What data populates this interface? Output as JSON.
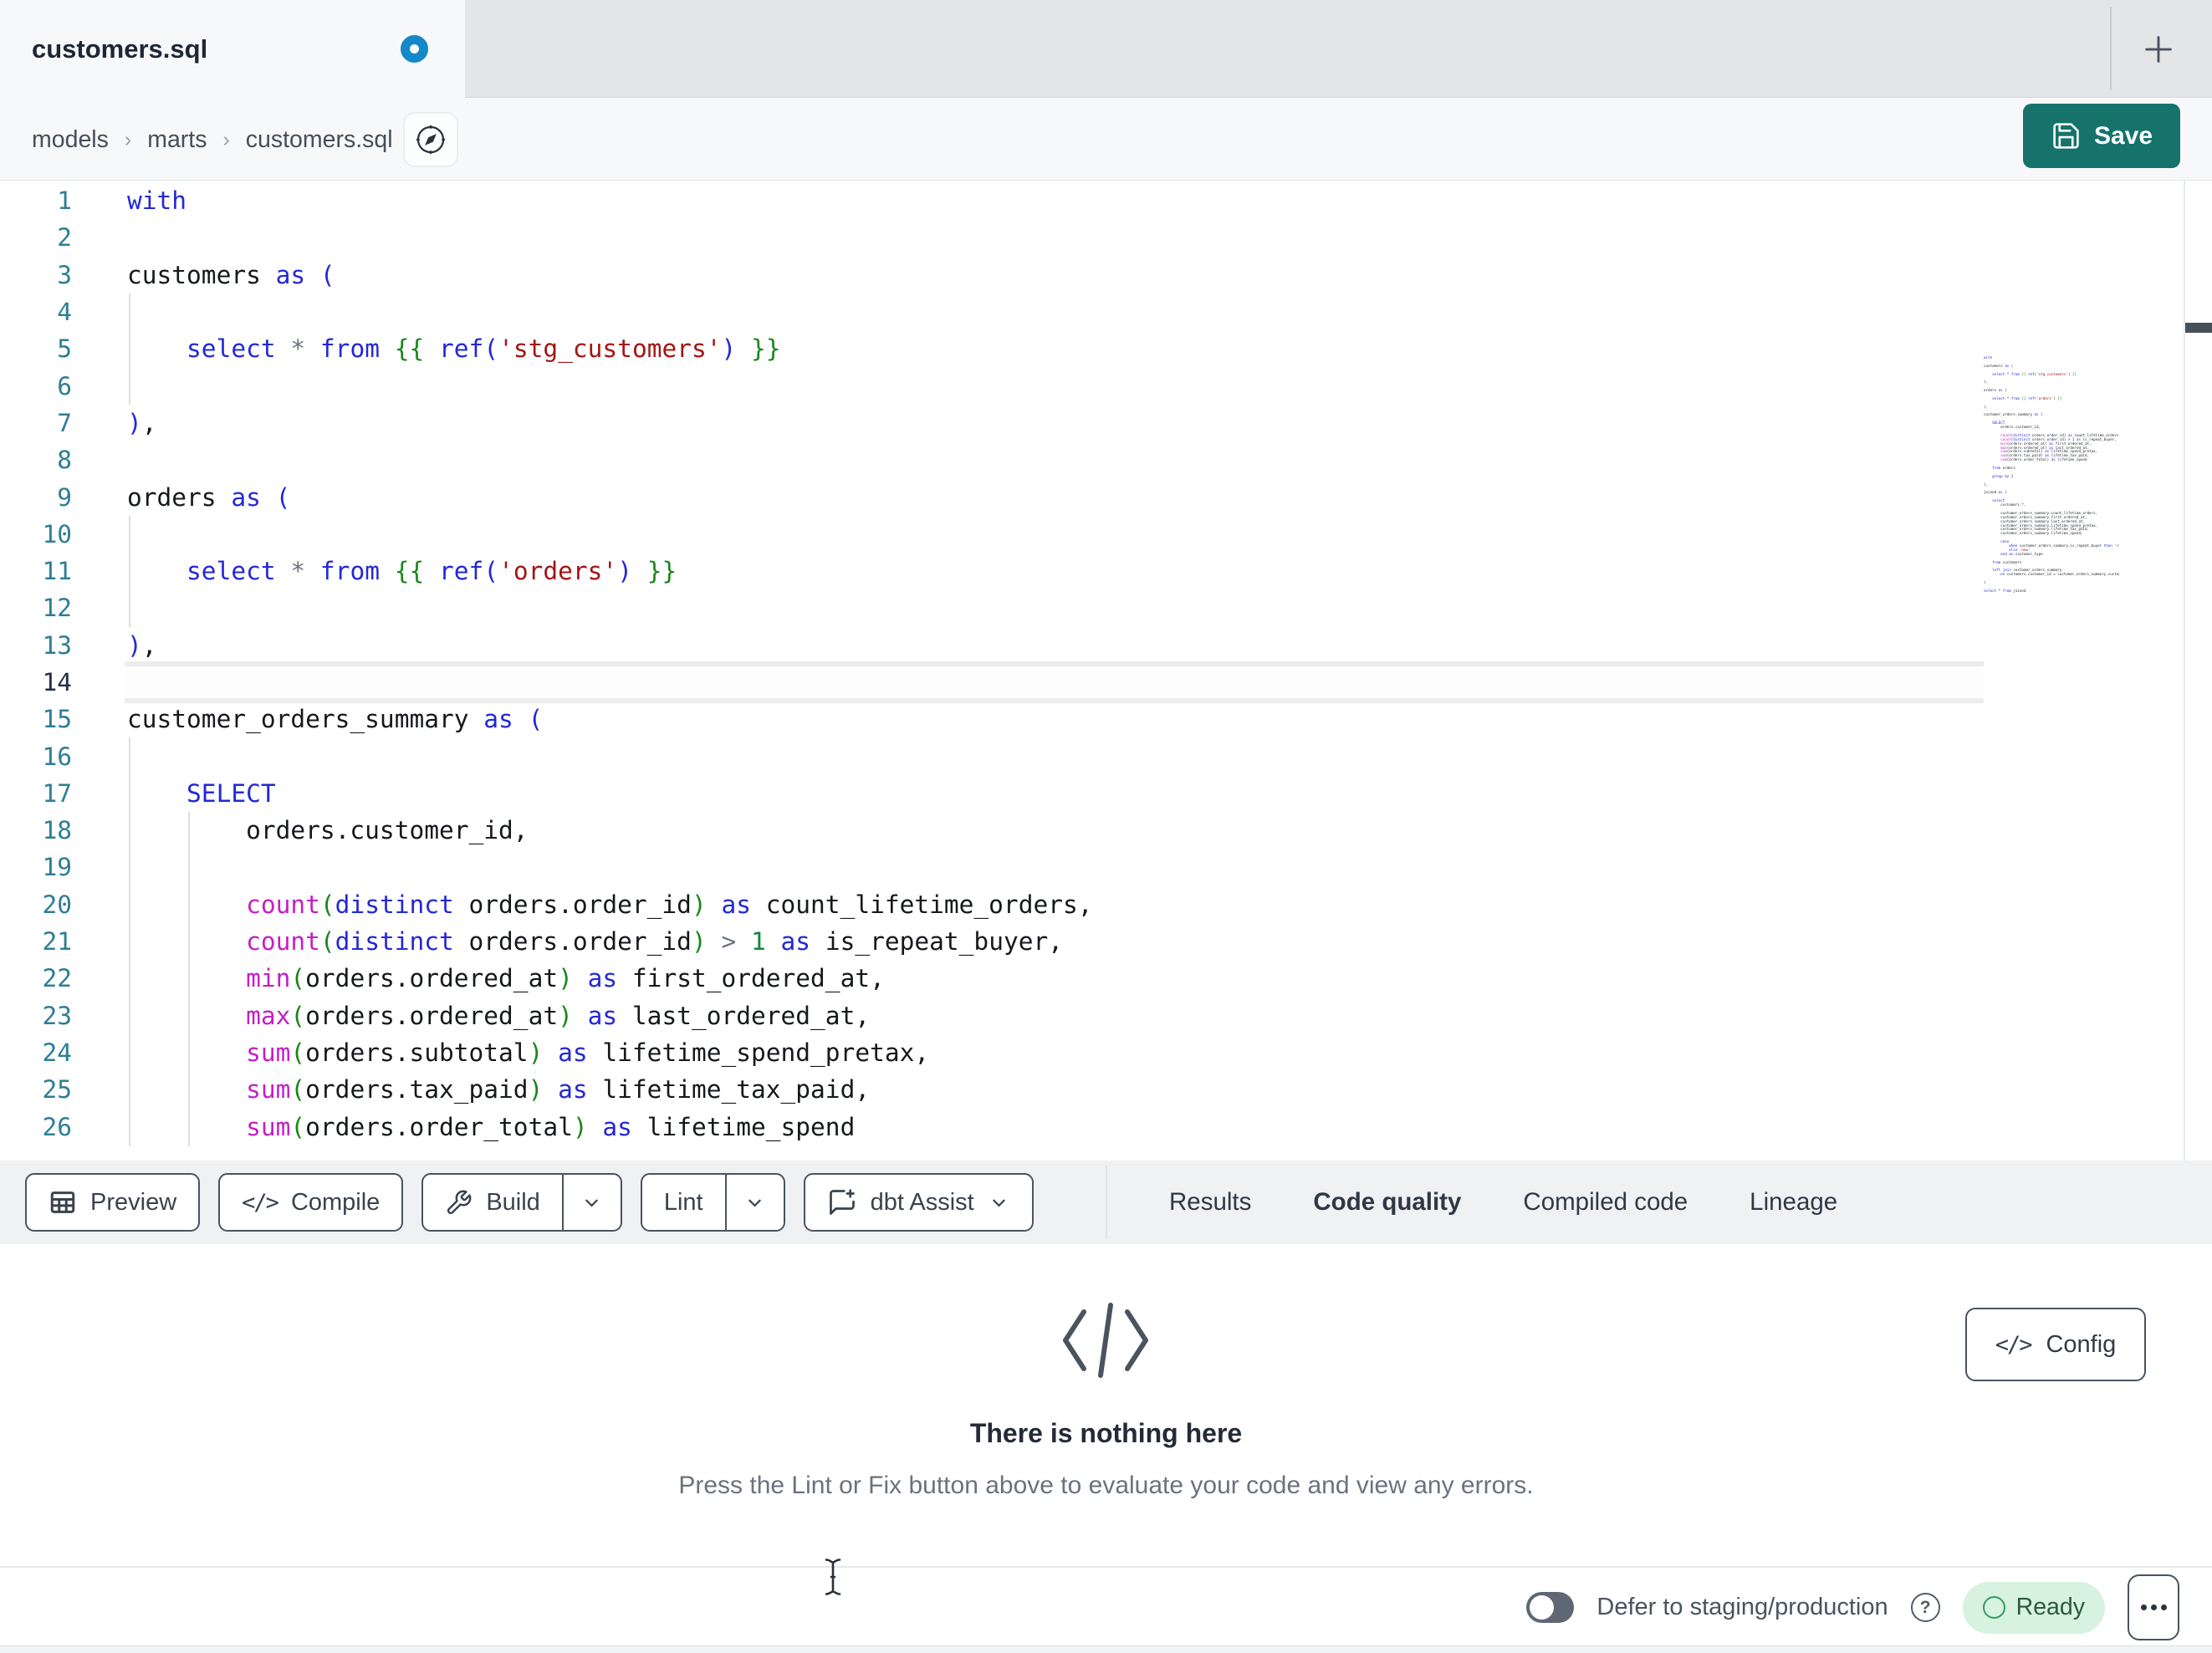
{
  "window": {
    "tab_title": "customers.sql",
    "new_tab_glyph": "+"
  },
  "breadcrumb": {
    "items": [
      "models",
      "marts",
      "customers.sql"
    ],
    "separator": "›"
  },
  "actions": {
    "save": "Save",
    "config": "Config",
    "config_glyph": "</>"
  },
  "toolbar": {
    "preview": "Preview",
    "compile": "Compile",
    "compile_glyph": "</>",
    "build": "Build",
    "lint": "Lint",
    "assist": "dbt Assist"
  },
  "result_tabs": [
    {
      "label": "Results",
      "active": false
    },
    {
      "label": "Code quality",
      "active": true
    },
    {
      "label": "Compiled code",
      "active": false
    },
    {
      "label": "Lineage",
      "active": false
    }
  ],
  "empty_state": {
    "title": "There is nothing here",
    "subtitle": "Press the Lint or Fix button above to evaluate your code and view any errors."
  },
  "status_bar": {
    "defer_label": "Defer to staging/production",
    "help_glyph": "?",
    "ready_label": "Ready"
  },
  "icons": {
    "unsaved_dot": "blue-ring",
    "new_tab": "plus",
    "file_nav": "compass",
    "save": "floppy-disk",
    "preview": "table-grid",
    "compile": "code-brackets",
    "build": "wrench",
    "assist": "chat-sparkle",
    "dropdown": "chevron-down",
    "empty_state": "code-brackets",
    "help": "question-circle",
    "ready": "green-ring",
    "more": "three-dots",
    "mouse": "i-beam-cursor"
  },
  "colors": {
    "save_teal": "#15736B",
    "unsaved_dot_blue": "#1488C9",
    "tabstrip_gray": "#E4E5E7",
    "toolbar_band": "#EFF1F3",
    "keyword_blue": "#2328D6",
    "function_magenta": "#C41FC4",
    "string_red": "#A31515",
    "bracket_green": "#1A871A",
    "number_green": "#13863F",
    "line_number_teal": "#2E7E95",
    "ready_badge_bg": "#D8F2E0",
    "ready_green": "#2F9E5F",
    "active_tab_underline": "#9AA1A9"
  },
  "editor": {
    "active_line": 14,
    "lines": [
      {
        "n": 1,
        "seg": [
          [
            "kw",
            "with"
          ]
        ]
      },
      {
        "n": 2,
        "seg": []
      },
      {
        "n": 3,
        "seg": [
          [
            "pl",
            "customers "
          ],
          [
            "kw",
            "as"
          ],
          [
            "pl",
            " "
          ],
          [
            "kw",
            "("
          ]
        ]
      },
      {
        "n": 4,
        "seg": []
      },
      {
        "n": 5,
        "seg": [
          [
            "pl",
            "    "
          ],
          [
            "kw",
            "select"
          ],
          [
            "pl",
            " "
          ],
          [
            "op",
            "*"
          ],
          [
            "pl",
            " "
          ],
          [
            "kw",
            "from"
          ],
          [
            "pl",
            " "
          ],
          [
            "jj",
            "{{"
          ],
          [
            "pl",
            " "
          ],
          [
            "kw",
            "ref"
          ],
          [
            "kw",
            "("
          ],
          [
            "str",
            "'stg_customers'"
          ],
          [
            "kw",
            ")"
          ],
          [
            "pl",
            " "
          ],
          [
            "jj",
            "}}"
          ]
        ]
      },
      {
        "n": 6,
        "seg": []
      },
      {
        "n": 7,
        "seg": [
          [
            "kw",
            ")"
          ],
          [
            "pl",
            ","
          ]
        ]
      },
      {
        "n": 8,
        "seg": []
      },
      {
        "n": 9,
        "seg": [
          [
            "pl",
            "orders "
          ],
          [
            "kw",
            "as"
          ],
          [
            "pl",
            " "
          ],
          [
            "kw",
            "("
          ]
        ]
      },
      {
        "n": 10,
        "seg": []
      },
      {
        "n": 11,
        "seg": [
          [
            "pl",
            "    "
          ],
          [
            "kw",
            "select"
          ],
          [
            "pl",
            " "
          ],
          [
            "op",
            "*"
          ],
          [
            "pl",
            " "
          ],
          [
            "kw",
            "from"
          ],
          [
            "pl",
            " "
          ],
          [
            "jj",
            "{{"
          ],
          [
            "pl",
            " "
          ],
          [
            "kw",
            "ref"
          ],
          [
            "kw",
            "("
          ],
          [
            "str",
            "'orders'"
          ],
          [
            "kw",
            ")"
          ],
          [
            "pl",
            " "
          ],
          [
            "jj",
            "}}"
          ]
        ]
      },
      {
        "n": 12,
        "seg": []
      },
      {
        "n": 13,
        "seg": [
          [
            "kw",
            ")"
          ],
          [
            "pl",
            ","
          ]
        ]
      },
      {
        "n": 14,
        "seg": []
      },
      {
        "n": 15,
        "seg": [
          [
            "pl",
            "customer_orders_summary "
          ],
          [
            "kw",
            "as"
          ],
          [
            "pl",
            " "
          ],
          [
            "kw",
            "("
          ]
        ]
      },
      {
        "n": 16,
        "seg": []
      },
      {
        "n": 17,
        "seg": [
          [
            "pl",
            "    "
          ],
          [
            "kw",
            "SELECT"
          ]
        ]
      },
      {
        "n": 18,
        "seg": [
          [
            "pl",
            "        orders.customer_id,"
          ]
        ]
      },
      {
        "n": 19,
        "seg": []
      },
      {
        "n": 20,
        "seg": [
          [
            "pl",
            "        "
          ],
          [
            "fn",
            "count"
          ],
          [
            "br",
            "("
          ],
          [
            "kw",
            "distinct"
          ],
          [
            "pl",
            " orders.order_id"
          ],
          [
            "br",
            ")"
          ],
          [
            "pl",
            " "
          ],
          [
            "kw",
            "as"
          ],
          [
            "pl",
            " count_lifetime_orders,"
          ]
        ]
      },
      {
        "n": 21,
        "seg": [
          [
            "pl",
            "        "
          ],
          [
            "fn",
            "count"
          ],
          [
            "br",
            "("
          ],
          [
            "kw",
            "distinct"
          ],
          [
            "pl",
            " orders.order_id"
          ],
          [
            "br",
            ")"
          ],
          [
            "pl",
            " "
          ],
          [
            "op",
            ">"
          ],
          [
            "pl",
            " "
          ],
          [
            "num",
            "1"
          ],
          [
            "pl",
            " "
          ],
          [
            "kw",
            "as"
          ],
          [
            "pl",
            " is_repeat_buyer,"
          ]
        ]
      },
      {
        "n": 22,
        "seg": [
          [
            "pl",
            "        "
          ],
          [
            "fn",
            "min"
          ],
          [
            "br",
            "("
          ],
          [
            "pl",
            "orders.ordered_at"
          ],
          [
            "br",
            ")"
          ],
          [
            "pl",
            " "
          ],
          [
            "kw",
            "as"
          ],
          [
            "pl",
            " first_ordered_at,"
          ]
        ]
      },
      {
        "n": 23,
        "seg": [
          [
            "pl",
            "        "
          ],
          [
            "fn",
            "max"
          ],
          [
            "br",
            "("
          ],
          [
            "pl",
            "orders.ordered_at"
          ],
          [
            "br",
            ")"
          ],
          [
            "pl",
            " "
          ],
          [
            "kw",
            "as"
          ],
          [
            "pl",
            " last_ordered_at,"
          ]
        ]
      },
      {
        "n": 24,
        "seg": [
          [
            "pl",
            "        "
          ],
          [
            "fn",
            "sum"
          ],
          [
            "br",
            "("
          ],
          [
            "pl",
            "orders.subtotal"
          ],
          [
            "br",
            ")"
          ],
          [
            "pl",
            " "
          ],
          [
            "kw",
            "as"
          ],
          [
            "pl",
            " lifetime_spend_pretax,"
          ]
        ]
      },
      {
        "n": 25,
        "seg": [
          [
            "pl",
            "        "
          ],
          [
            "fn",
            "sum"
          ],
          [
            "br",
            "("
          ],
          [
            "pl",
            "orders.tax_paid"
          ],
          [
            "br",
            ")"
          ],
          [
            "pl",
            " "
          ],
          [
            "kw",
            "as"
          ],
          [
            "pl",
            " lifetime_tax_paid,"
          ]
        ]
      },
      {
        "n": 26,
        "seg": [
          [
            "pl",
            "        "
          ],
          [
            "fn",
            "sum"
          ],
          [
            "br",
            "("
          ],
          [
            "pl",
            "orders.order_total"
          ],
          [
            "br",
            ")"
          ],
          [
            "pl",
            " "
          ],
          [
            "kw",
            "as"
          ],
          [
            "pl",
            " lifetime_spend"
          ]
        ]
      }
    ],
    "minimap_lines": [
      "with",
      "",
      "customers as (",
      "",
      "    select * from {{ ref('stg_customers') }}",
      "",
      "),",
      "",
      "orders as (",
      "",
      "    select * from {{ ref('orders') }}",
      "",
      "),",
      "",
      "customer_orders_summary as (",
      "",
      "    SELECT",
      "        orders.customer_id,",
      "",
      "        count(distinct orders.order_id) as count_lifetime_orders,",
      "        count(distinct orders.order_id) > 1 as is_repeat_buyer,",
      "        min(orders.ordered_at) as first_ordered_at,",
      "        max(orders.ordered_at) as last_ordered_at,",
      "        sum(orders.subtotal) as lifetime_spend_pretax,",
      "        sum(orders.tax_paid) as lifetime_tax_paid,",
      "        sum(orders.order_total) as lifetime_spend",
      "",
      "    from orders",
      "",
      "    group by 1",
      "",
      "),",
      "",
      "joined as (",
      "",
      "    select",
      "        customers.*,",
      "",
      "        customer_orders_summary.count_lifetime_orders,",
      "        customer_orders_summary.first_ordered_at,",
      "        customer_orders_summary.last_ordered_at,",
      "        customer_orders_summary.lifetime_spend_pretax,",
      "        customer_orders_summary.lifetime_tax_paid,",
      "        customer_orders_summary.lifetime_spend,",
      "",
      "        case",
      "            when customer_orders_summary.is_repeat_buyer then 'returning'",
      "            else 'new'",
      "        end as customer_type",
      "",
      "    from customers",
      "",
      "    left join customer_orders_summary",
      "        on customers.customer_id = customer_orders_summary.customer_id",
      "",
      ")",
      "",
      "select * from joined"
    ]
  }
}
